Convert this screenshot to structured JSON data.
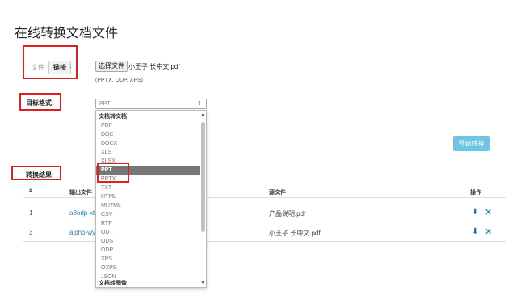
{
  "page": {
    "title": "在线转换文档文件"
  },
  "source": {
    "tabs": [
      "文件",
      "链接"
    ],
    "colon": ":",
    "choose_label": "选择文件",
    "file_name": "小王子 长中文.pdf",
    "hint": "(PPTX, ODP, XPS)"
  },
  "target": {
    "label": "目标格式:",
    "selected": "PPT"
  },
  "start_button": "开始转换",
  "result": {
    "label": "转换结果:"
  },
  "table": {
    "headers": [
      "#",
      "输出文件",
      "源文件",
      "操作"
    ],
    "rows": [
      {
        "index": "1",
        "output": "a8odp-xt",
        "source": "产品说明.pdf"
      },
      {
        "index": "3",
        "output": "ajpho-wy",
        "source": "小王子 长中文.pdf"
      }
    ]
  },
  "dropdown": {
    "items": [
      "文档转文档",
      "PDF",
      "DOC",
      "DOCX",
      "XLS",
      "XLSX",
      "PPT",
      "PPTX",
      "TXT",
      "HTML",
      "MHTML",
      "CSV",
      "RTF",
      "ODT",
      "ODS",
      "ODP",
      "XPS",
      "OXPS",
      "JSON",
      "文档转图像"
    ]
  },
  "icons": {
    "download": "download-icon",
    "delete": "close-icon",
    "caret": "updown-caret-icon"
  },
  "colors": {
    "highlight": "#e02020",
    "accent": "#6bc7e3",
    "link": "#2a7fb5",
    "selected_bg": "#777777"
  }
}
